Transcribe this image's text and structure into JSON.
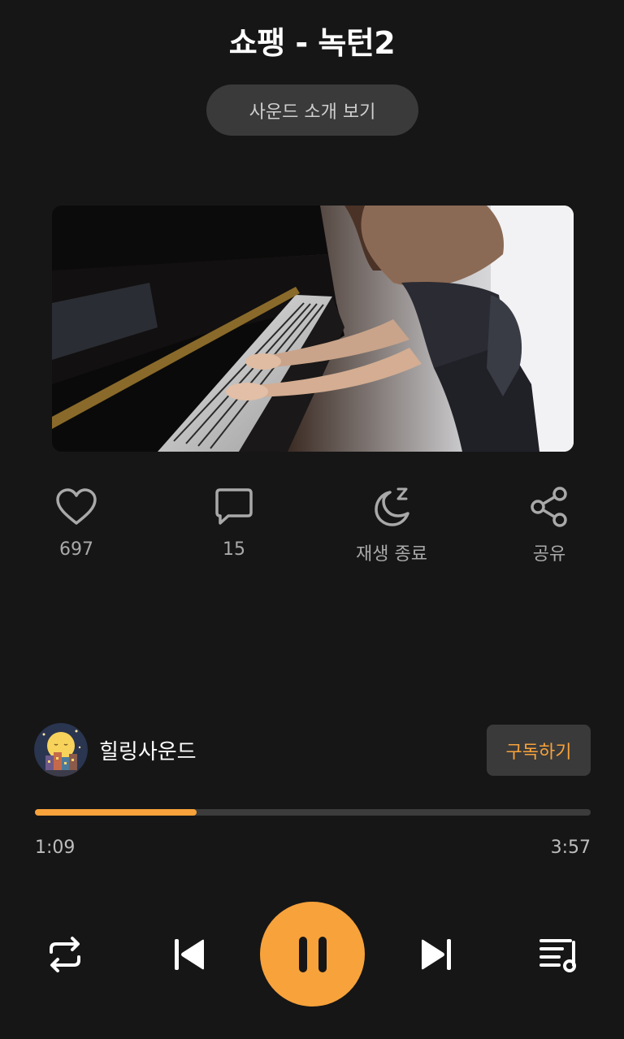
{
  "title": "쇼팽 - 녹턴2",
  "intro_button": "사운드 소개 보기",
  "video": {
    "thumbnail_icon": "piano-player-thumbnail"
  },
  "actions": [
    {
      "label": "697",
      "icon": "heart-icon"
    },
    {
      "label": "15",
      "icon": "comment-icon"
    },
    {
      "label": "재생 종료",
      "icon": "sleep-timer-moon-icon"
    },
    {
      "label": "공유",
      "icon": "share-icon"
    }
  ],
  "channel": {
    "name": "힐링사운드",
    "avatar_icon": "night-moon-avatar"
  },
  "subscribe_label": "구독하기",
  "progress": {
    "current": "1:09",
    "total": "3:57",
    "fraction": 0.291
  },
  "controls": {
    "repeat_icon": "repeat-icon",
    "prev_icon": "skip-previous-icon",
    "pause_icon": "pause-icon",
    "next_icon": "skip-next-icon",
    "playlist_icon": "playlist-icon"
  },
  "colors": {
    "background": "#161616",
    "accent": "#f7a23b",
    "button_bg": "#3a3a3a",
    "muted_text": "#a9a9a9"
  }
}
